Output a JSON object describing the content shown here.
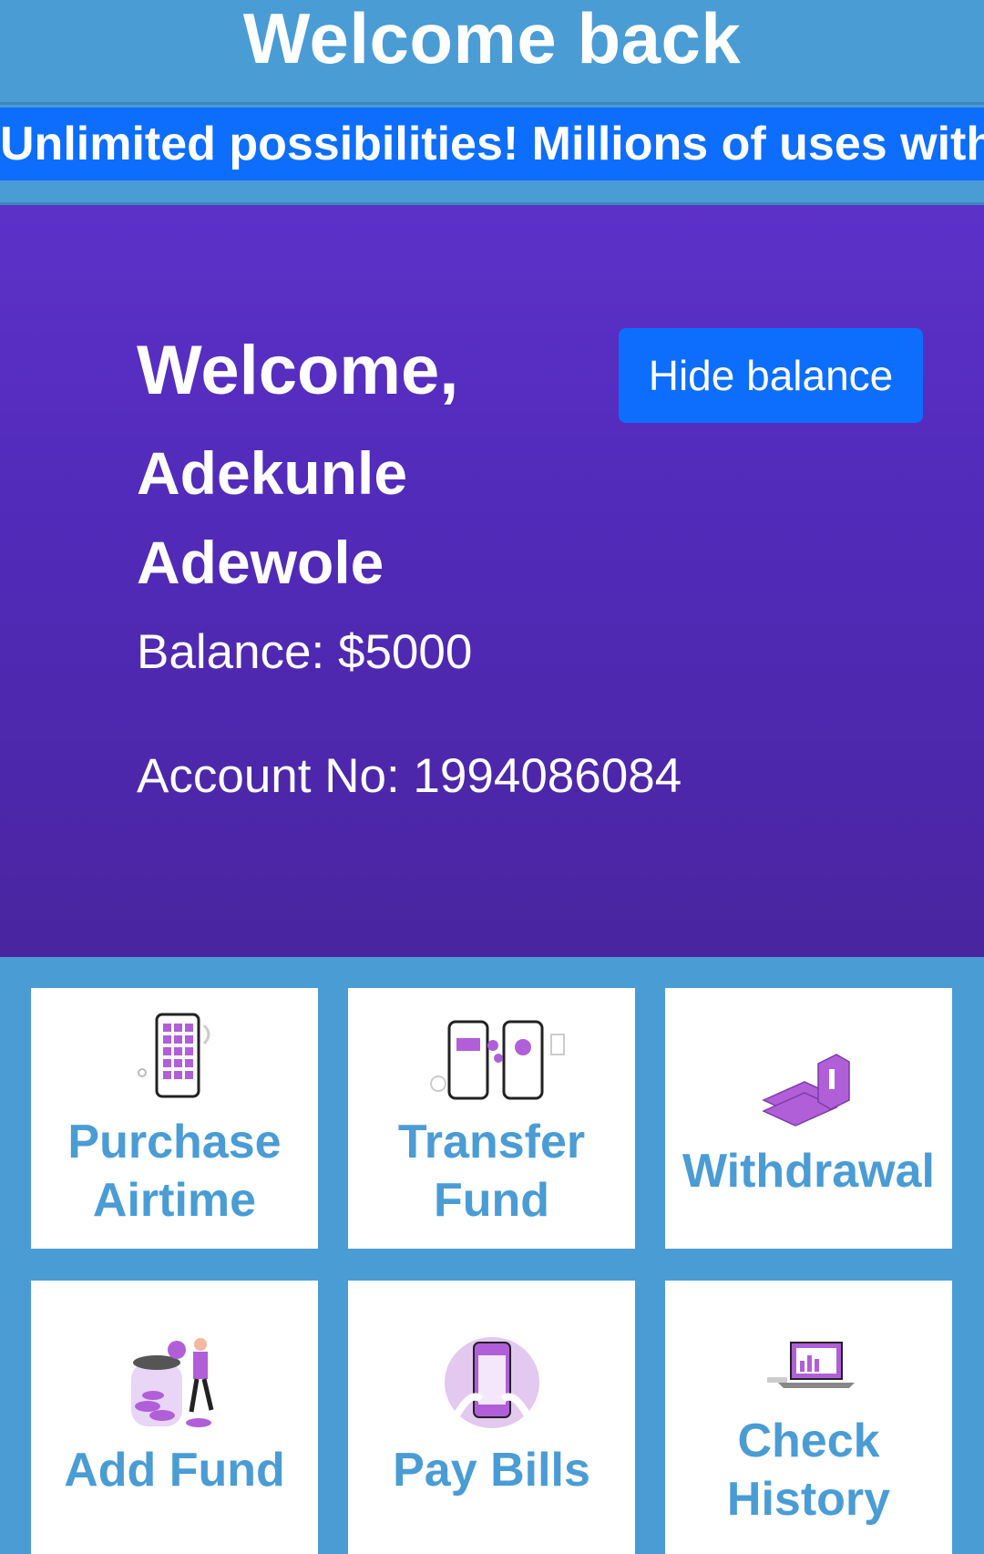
{
  "header": {
    "title": "Welcome back"
  },
  "marquee": {
    "text": "Unlimited possibilities! Millions of uses with"
  },
  "hero": {
    "welcome": "Welcome,",
    "name": "Adekunle Adewole",
    "balance": "Balance: $5000",
    "account": "Account No: 1994086084",
    "hide_button": "Hide balance"
  },
  "services": [
    {
      "label": "Purchase Airtime",
      "icon": "phone-apps-illustration"
    },
    {
      "label": "Transfer Fund",
      "icon": "phone-transfer-illustration"
    },
    {
      "label": "Withdrawal",
      "icon": "cash-stack-illustration"
    },
    {
      "label": "Add Fund",
      "icon": "coin-jar-illustration"
    },
    {
      "label": "Pay Bills",
      "icon": "payment-phone-illustration"
    },
    {
      "label": "Check History",
      "icon": "laptop-history-illustration"
    }
  ],
  "colors": {
    "primary": "#4a9cd5",
    "button": "#0d6efd",
    "hero": "#5530c0",
    "accent": "#b05fd9"
  }
}
